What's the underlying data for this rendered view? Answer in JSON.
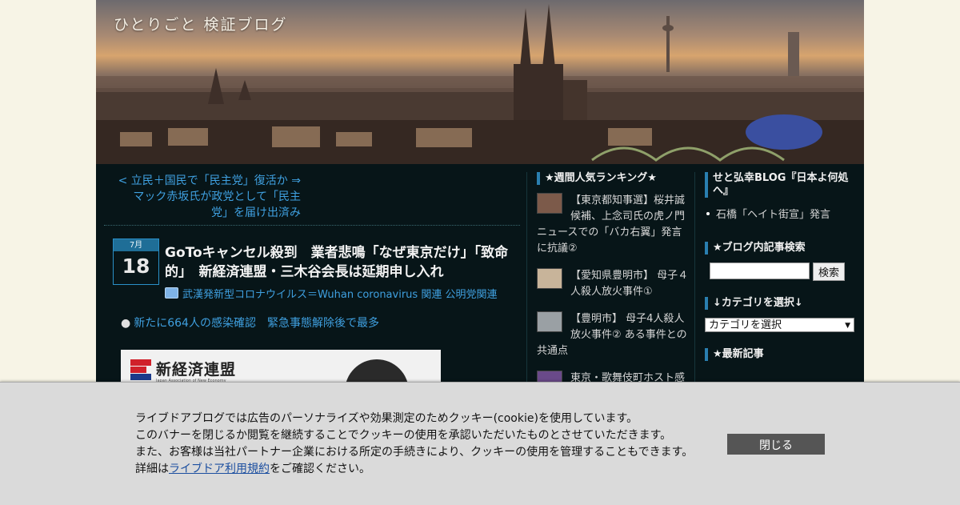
{
  "site": {
    "title": "ひとりごと 検証ブログ"
  },
  "main": {
    "prev_link": "< 立民＋国民で「民主党」復活か ⇒ マック赤坂氏が政党として「民主党」を届け出済み",
    "date": {
      "month": "7月",
      "day": "18"
    },
    "post_title": "GoToキャンセル殺到　業者悲鳴「なぜ東京だけ」「致命的」　新経済連盟・三木谷会長は延期申し入れ",
    "categories": "武漢発新型コロナウイルス＝Wuhan coronavirus 関連",
    "categories2": "公明党関連",
    "bullet_link": "新たに664人の感染確認　緊急事態解除後で最多",
    "image": {
      "logo_text": "新経済連盟",
      "logo_sub": "Japan Association of New Economy"
    }
  },
  "ranking": {
    "title": "★週間人気ランキング★",
    "items": [
      {
        "text": "【東京都知事選】桜井誠候補、上念司氏の虎ノ門ニュースでの「バカ右翼」発言に抗議②"
      },
      {
        "text": "【愛知県豊明市】 母子４人殺人放火事件①"
      },
      {
        "text": "【豊明市】 母子4人殺人放火事件② ある事件との共通点"
      },
      {
        "text": "東京・歌舞伎町ホスト感"
      }
    ]
  },
  "sidebar": {
    "blog_title": "せと弘幸BLOG『日本よ何処へ』",
    "blog_link": "石橋「ヘイト街宣」発言",
    "search_title": "★ブログ内記事検索",
    "search_button": "検索",
    "category_title": "↓カテゴリを選択↓",
    "category_select": "カテゴリを選択",
    "recent_title": "★最新記事"
  },
  "cookie": {
    "line1": "ライブドアブログでは広告のパーソナライズや効果測定のためクッキー(cookie)を使用しています。",
    "line2": "このバナーを閉じるか閲覧を継続することでクッキーの使用を承認いただいたものとさせていただきます。",
    "line3": "また、お客様は当社パートナー企業における所定の手続きにより、クッキーの使用を管理することもできます。",
    "line4_prefix": "詳細は",
    "line4_link": "ライブドア利用規約",
    "line4_suffix": "をご確認ください。",
    "close_button": "閉じる"
  }
}
